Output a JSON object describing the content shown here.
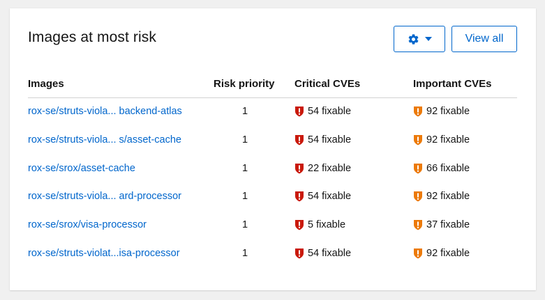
{
  "card": {
    "title": "Images at most risk",
    "settings_icon": "gear-icon",
    "dropdown_icon": "caret-down-icon",
    "view_all_label": "View all"
  },
  "table": {
    "headers": {
      "images": "Images",
      "risk": "Risk priority",
      "critical": "Critical CVEs",
      "important": "Important CVEs"
    },
    "rows": [
      {
        "image": "rox-se/struts-viola... backend-atlas",
        "risk": "1",
        "critical": "54 fixable",
        "important": "92 fixable"
      },
      {
        "image": "rox-se/struts-viola... s/asset-cache",
        "risk": "1",
        "critical": "54 fixable",
        "important": "92 fixable"
      },
      {
        "image": "rox-se/srox/asset-cache",
        "risk": "1",
        "critical": "22 fixable",
        "important": "66 fixable"
      },
      {
        "image": "rox-se/struts-viola... ard-processor",
        "risk": "1",
        "critical": "54 fixable",
        "important": "92 fixable"
      },
      {
        "image": "rox-se/srox/visa-processor",
        "risk": "1",
        "critical": "5 fixable",
        "important": "37 fixable"
      },
      {
        "image": "rox-se/struts-violat...isa-processor",
        "risk": "1",
        "critical": "54 fixable",
        "important": "92 fixable"
      }
    ]
  },
  "colors": {
    "link": "#0066cc",
    "critical": "#c9190b",
    "important": "#ec7a08"
  }
}
